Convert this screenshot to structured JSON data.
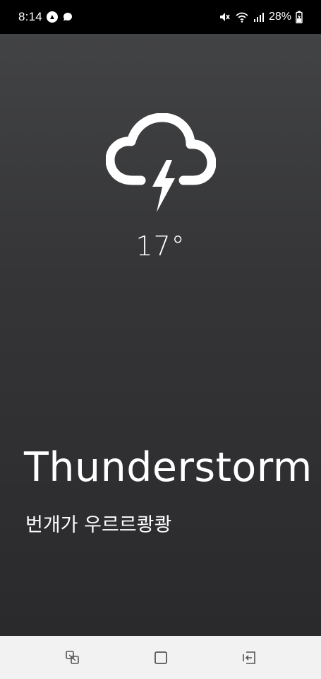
{
  "status_bar": {
    "time": "8:14",
    "battery": "28%",
    "icons": [
      "navigation-app-icon",
      "chat-icon",
      "mute-icon",
      "wifi-icon",
      "signal-icon",
      "battery-charging-icon"
    ]
  },
  "weather": {
    "icon": "thunderstorm-icon",
    "temperature": "17°",
    "condition": "Thunderstorm",
    "subtitle": "번개가 우르르쾅쾅"
  },
  "nav_bar": {
    "buttons": [
      "recent-apps-icon",
      "home-icon",
      "back-icon"
    ]
  },
  "colors": {
    "background_top": "#424345",
    "background_bottom": "#2a2a2c",
    "text": "#ffffff",
    "nav_bar": "#f2f2f2"
  }
}
